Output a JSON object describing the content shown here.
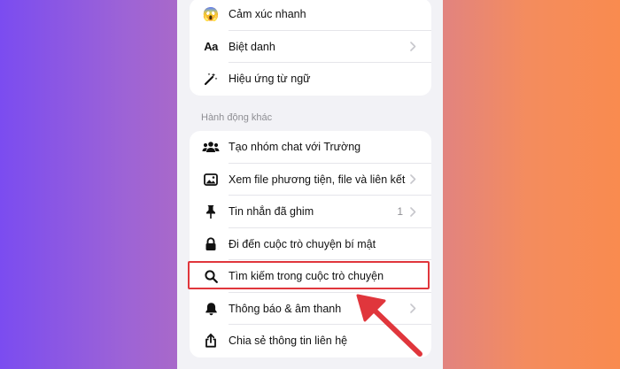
{
  "top_group": [
    {
      "label": "Cảm xúc nhanh",
      "icon": "shocked-emoji-icon",
      "chevron": false
    },
    {
      "label": "Biệt danh",
      "icon": "aa-text-icon",
      "chevron": true
    },
    {
      "label": "Hiệu ứng từ ngữ",
      "icon": "magic-wand-icon",
      "chevron": false
    }
  ],
  "section_label": "Hành động khác",
  "actions": [
    {
      "label": "Tạo nhóm chat với Trường",
      "icon": "group-people-icon",
      "chevron": false,
      "count": ""
    },
    {
      "label": "Xem file phương tiện, file và liên kết",
      "icon": "image-icon",
      "chevron": true,
      "count": ""
    },
    {
      "label": "Tin nhắn đã ghim",
      "icon": "pin-icon",
      "chevron": true,
      "count": "1"
    },
    {
      "label": "Đi đến cuộc trò chuyện bí mật",
      "icon": "lock-icon",
      "chevron": false,
      "count": ""
    },
    {
      "label": "Tìm kiếm trong cuộc trò chuyện",
      "icon": "search-icon",
      "chevron": false,
      "count": ""
    },
    {
      "label": "Thông báo & âm thanh",
      "icon": "bell-icon",
      "chevron": true,
      "count": ""
    },
    {
      "label": "Chia sẻ thông tin liên hệ",
      "icon": "share-icon",
      "chevron": false,
      "count": ""
    }
  ],
  "colors": {
    "highlight": "#e0363c",
    "arrow": "#e0363c"
  }
}
